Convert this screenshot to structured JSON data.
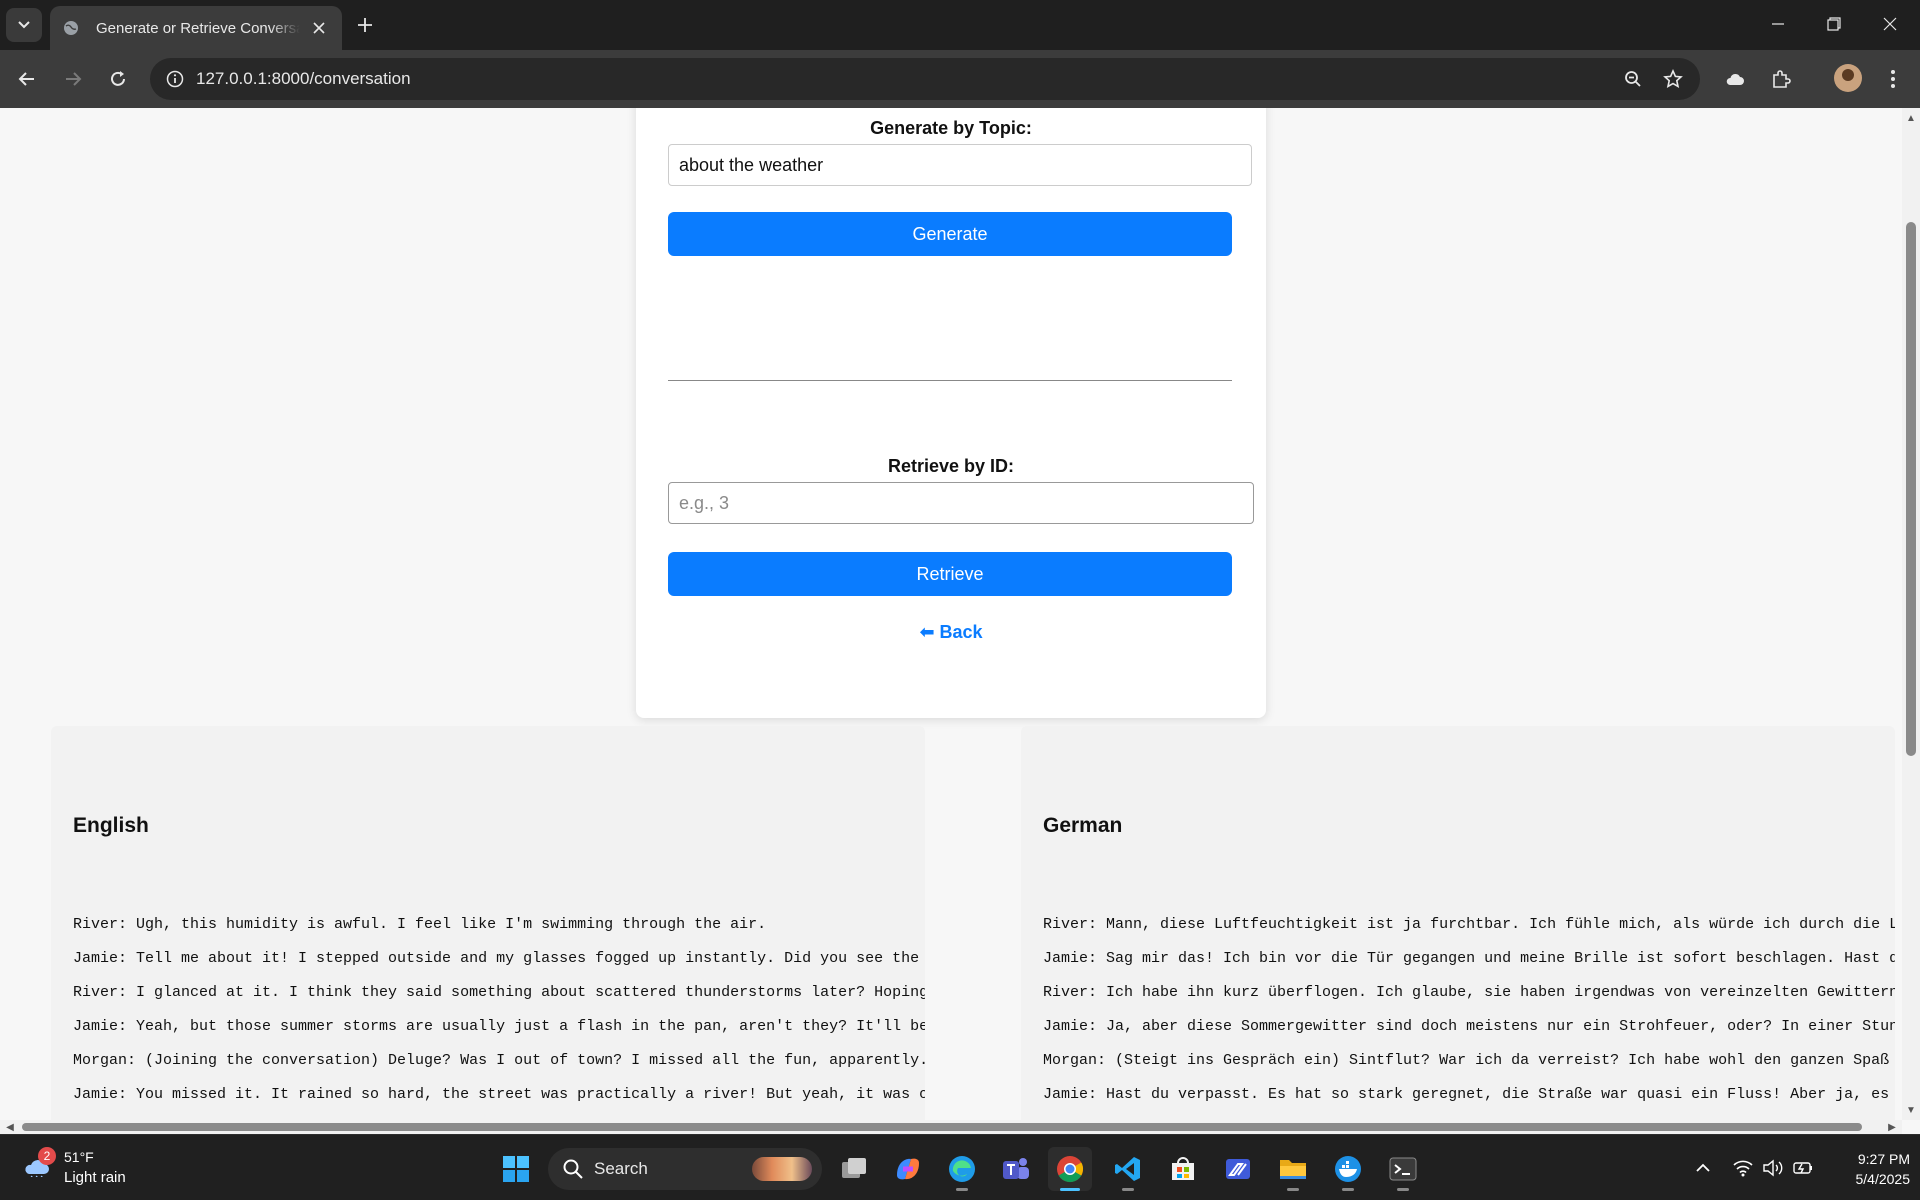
{
  "browser": {
    "tab_title": "Generate or Retrieve Conversation",
    "url": "127.0.0.1:8000/conversation"
  },
  "form": {
    "topic_label": "Generate by Topic:",
    "topic_value": "about the weather",
    "generate_label": "Generate",
    "id_label": "Retrieve by ID:",
    "id_placeholder": "e.g., 3",
    "retrieve_label": "Retrieve",
    "back_label": "⬅ Back"
  },
  "panels": {
    "english": {
      "title": "English",
      "text": "River: Ugh, this humidity is awful. I feel like I'm swimming through the air.\nJamie: Tell me about it! I stepped outside and my glasses fogged up instantly. Did you see the forecast?\nRiver: I glanced at it. I think they said something about scattered thunderstorms later? Hoping it actually cools things down.\nJamie: Yeah, but those summer storms are usually just a flash in the pan, aren't they? It'll be back to sweltering in an hour.\nMorgan: (Joining the conversation) Deluge? Was I out of town? I missed all the fun, apparently. I thought it was just hot.\nJamie: You missed it. It rained so hard, the street was practically a river! But yeah, it was only for like ten minutes.\nRiver: Exactly! Makes no difference. This heat wave just won't let up. I keep thinking maybe it will break soon."
    },
    "german": {
      "title": "German",
      "text": "River: Mann, diese Luftfeuchtigkeit ist ja furchtbar. Ich fühle mich, als würde ich durch die Luft schwimmen.\nJamie: Sag mir das! Ich bin vor die Tür gegangen und meine Brille ist sofort beschlagen. Hast du den Wetterbericht gesehen?\nRiver: Ich habe ihn kurz überflogen. Ich glaube, sie haben irgendwas von vereinzelten Gewittern später gesagt.\nJamie: Ja, aber diese Sommergewitter sind doch meistens nur ein Strohfeuer, oder? In einer Stunde ist es wieder heiß.\nMorgan: (Steigt ins Gespräch ein) Sintflut? War ich da verreist? Ich habe wohl den ganzen Spaß verpasst. Ich dachte, es wäre nur heiß.\nJamie: Hast du verpasst. Es hat so stark geregnet, die Straße war quasi ein Fluss! Aber ja, es war nur für zehn Minuten.\nRiver: Genau! Macht keinen Unterschied. Diese Hitzewelle lässt einfach nicht nach. Ich denke immer, dass sie bald endet."
    }
  },
  "taskbar": {
    "weather_badge": "2",
    "temperature": "51°F",
    "condition": "Light rain",
    "search_label": "Search",
    "time": "9:27 PM",
    "date": "5/4/2025"
  },
  "colors": {
    "accent": "#0a7cff",
    "chrome_dark": "#1f1f1f",
    "toolbar": "#3c3c3c"
  }
}
